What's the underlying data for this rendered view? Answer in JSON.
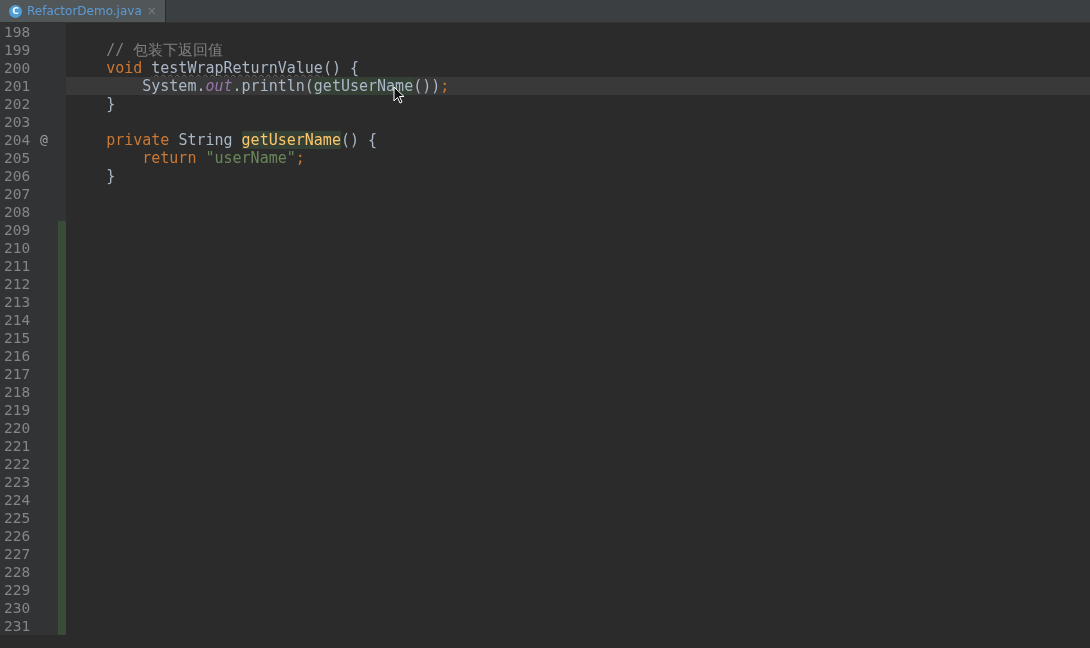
{
  "tabs": [
    {
      "icon_letter": "C",
      "label": "RefactorDemo.java",
      "close": "×",
      "selected": true
    }
  ],
  "editor": {
    "lines": [
      {
        "number": "198",
        "current": false,
        "changed": false
      },
      {
        "number": "199",
        "current": false,
        "changed": false,
        "tokens": [
          {
            "kind": "comment",
            "text": "    // 包装下返回值"
          }
        ]
      },
      {
        "number": "200",
        "current": false,
        "changed": false,
        "tokens": [
          {
            "kind": "keyword",
            "text": "    void"
          },
          {
            "kind": "unused",
            "text": " testWrapReturnValue"
          },
          {
            "kind": "plain",
            "text": "() {"
          }
        ]
      },
      {
        "number": "201",
        "current": true,
        "changed": false,
        "tokens": [
          {
            "kind": "plain",
            "text": "        System."
          },
          {
            "kind": "field",
            "text": "out"
          },
          {
            "kind": "plain",
            "text": ".println("
          },
          {
            "kind": "usage",
            "text": "getUserName"
          },
          {
            "kind": "plain",
            "text": "())"
          },
          {
            "kind": "keyword",
            "text": ";"
          }
        ]
      },
      {
        "number": "202",
        "current": false,
        "changed": false,
        "tokens": [
          {
            "kind": "plain",
            "text": "    }"
          }
        ]
      },
      {
        "number": "203",
        "current": false,
        "changed": false
      },
      {
        "number": "204",
        "gutter_mark": "@",
        "current": false,
        "changed": false,
        "tokens": [
          {
            "kind": "keyword",
            "text": "    private"
          },
          {
            "kind": "plain",
            "text": " String "
          },
          {
            "kind": "declaration",
            "text": "getUserName"
          },
          {
            "kind": "plain",
            "text": "() {"
          }
        ]
      },
      {
        "number": "205",
        "current": false,
        "changed": false,
        "tokens": [
          {
            "kind": "keyword",
            "text": "        return"
          },
          {
            "kind": "string",
            "text": " \"userName\""
          },
          {
            "kind": "keyword",
            "text": ";"
          }
        ]
      },
      {
        "number": "206",
        "current": false,
        "changed": false,
        "tokens": [
          {
            "kind": "plain",
            "text": "    }"
          }
        ]
      },
      {
        "number": "207",
        "current": false,
        "changed": false
      },
      {
        "number": "208",
        "current": false,
        "changed": false
      },
      {
        "number": "209",
        "current": false,
        "changed": true
      },
      {
        "number": "210",
        "current": false,
        "changed": true
      },
      {
        "number": "211",
        "current": false,
        "changed": true
      },
      {
        "number": "212",
        "current": false,
        "changed": true
      },
      {
        "number": "213",
        "current": false,
        "changed": true
      },
      {
        "number": "214",
        "current": false,
        "changed": true
      },
      {
        "number": "215",
        "current": false,
        "changed": true
      },
      {
        "number": "216",
        "current": false,
        "changed": true
      },
      {
        "number": "217",
        "current": false,
        "changed": true
      },
      {
        "number": "218",
        "current": false,
        "changed": true
      },
      {
        "number": "219",
        "current": false,
        "changed": true
      },
      {
        "number": "220",
        "current": false,
        "changed": true
      },
      {
        "number": "221",
        "current": false,
        "changed": true
      },
      {
        "number": "222",
        "current": false,
        "changed": true
      },
      {
        "number": "223",
        "current": false,
        "changed": true
      },
      {
        "number": "224",
        "current": false,
        "changed": true
      },
      {
        "number": "225",
        "current": false,
        "changed": true
      },
      {
        "number": "226",
        "current": false,
        "changed": true
      },
      {
        "number": "227",
        "current": false,
        "changed": true
      },
      {
        "number": "228",
        "current": false,
        "changed": true
      },
      {
        "number": "229",
        "current": false,
        "changed": true
      },
      {
        "number": "230",
        "current": false,
        "changed": true
      },
      {
        "number": "231",
        "current": false,
        "changed": true
      }
    ]
  }
}
